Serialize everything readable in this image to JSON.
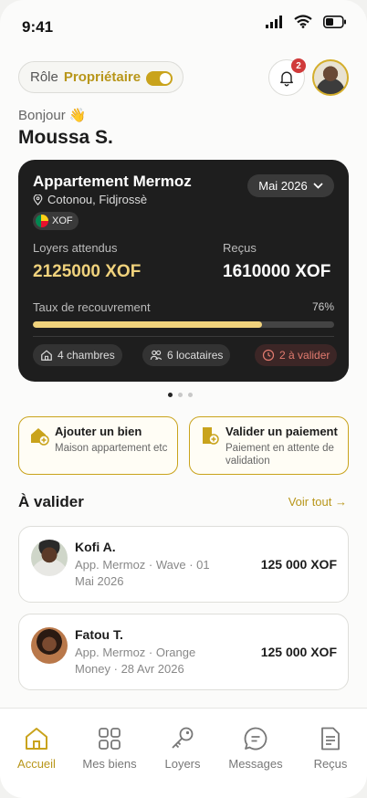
{
  "status_bar": {
    "time": "9:41"
  },
  "header": {
    "role_label": "Rôle",
    "role_value": "Propriétaire",
    "notification_count": "2",
    "greeting": "Bonjour 👋",
    "user_name": "Moussa S."
  },
  "property_card": {
    "title": "Appartement Mermoz",
    "location": "Cotonou, Fidjrossè",
    "currency": "XOF",
    "month": "Mai 2026",
    "expected_label": "Loyers attendus",
    "expected_value": "2125000 XOF",
    "received_label": "Reçus",
    "received_value": "1610000 XOF",
    "recovery_label": "Taux de recouvrement",
    "recovery_text": "76%",
    "recovery_fraction": 0.76,
    "chip_rooms": "4 chambres",
    "chip_tenants": "6 locataires",
    "chip_pending": "2 à valider"
  },
  "carousel": {
    "count": 3,
    "active": 0
  },
  "actions": [
    {
      "title": "Ajouter un bien",
      "desc": "Maison appartement etc",
      "icon": "house-plus-icon"
    },
    {
      "title": "Valider un paiement",
      "desc": "Paiement en attente de validation",
      "icon": "receipt-check-icon"
    }
  ],
  "pending_section": {
    "title": "À valider",
    "see_all": "Voir tout →",
    "items": [
      {
        "name": "Kofi A.",
        "detail": "App. Mermoz · Wave · 01 Mai 2026",
        "amount": "125 000 XOF"
      },
      {
        "name": "Fatou T.",
        "detail": "App. Mermoz · Orange Money · 28 Avr 2026",
        "amount": "125 000 XOF"
      }
    ]
  },
  "nav": [
    {
      "label": "Accueil",
      "icon": "home-icon",
      "active": true
    },
    {
      "label": "Mes biens",
      "icon": "grid-icon",
      "active": false
    },
    {
      "label": "Loyers",
      "icon": "key-icon",
      "active": false
    },
    {
      "label": "Messages",
      "icon": "chat-icon",
      "active": false
    },
    {
      "label": "Reçus",
      "icon": "document-icon",
      "active": false
    }
  ],
  "colors": {
    "accent": "#c9a31c",
    "card_dark": "#1e1e1e",
    "progress": "#f0d27c",
    "alert": "#e27b6f"
  }
}
